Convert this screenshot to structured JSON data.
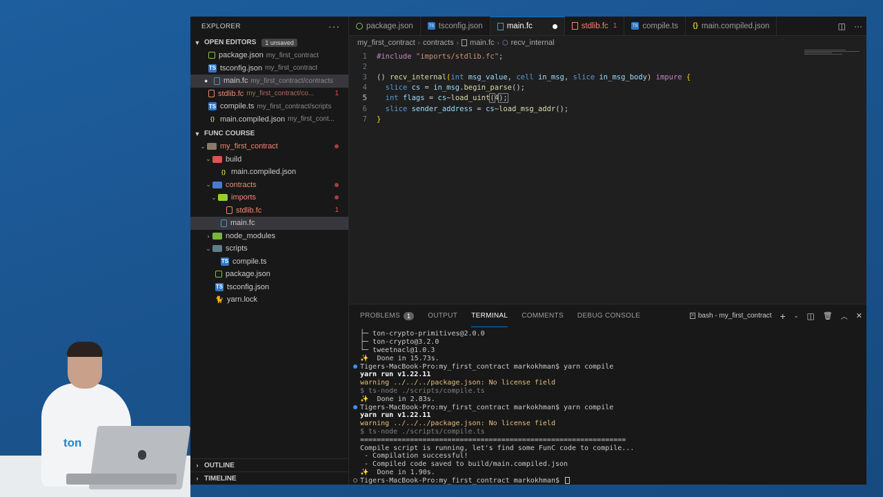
{
  "sidebar": {
    "header": "EXPLORER",
    "open_editors": {
      "title": "OPEN EDITORS",
      "badge": "1 unsaved",
      "items": [
        {
          "name": "package.json",
          "desc": "my_first_contract"
        },
        {
          "name": "tsconfig.json",
          "desc": "my_first_contract"
        },
        {
          "name": "main.fc",
          "desc": "my_first_contract/contracts"
        },
        {
          "name": "stdlib.fc",
          "desc": "my_first_contract/co...",
          "errors": "1"
        },
        {
          "name": "compile.ts",
          "desc": "my_first_contract/scripts"
        },
        {
          "name": "main.compiled.json",
          "desc": "my_first_cont..."
        }
      ]
    },
    "workspace": {
      "title": "FUNC COURSE",
      "items": [
        {
          "name": "my_first_contract"
        },
        {
          "name": "build"
        },
        {
          "name": "main.compiled.json"
        },
        {
          "name": "contracts"
        },
        {
          "name": "imports"
        },
        {
          "name": "stdlib.fc",
          "errors": "1"
        },
        {
          "name": "main.fc"
        },
        {
          "name": "node_modules"
        },
        {
          "name": "scripts"
        },
        {
          "name": "compile.ts"
        },
        {
          "name": "package.json"
        },
        {
          "name": "tsconfig.json"
        },
        {
          "name": "yarn.lock"
        }
      ]
    },
    "outline": "OUTLINE",
    "timeline": "TIMELINE"
  },
  "tabs": [
    {
      "label": "package.json"
    },
    {
      "label": "tsconfig.json"
    },
    {
      "label": "main.fc"
    },
    {
      "label": "stdlib.fc",
      "errors": "1"
    },
    {
      "label": "compile.ts"
    },
    {
      "label": "main.compiled.json"
    }
  ],
  "breadcrumb": [
    "my_first_contract",
    "contracts",
    "main.fc",
    "recv_internal"
  ],
  "code": {
    "line_numbers": [
      "1",
      "2",
      "3",
      "4",
      "5",
      "6",
      "7"
    ],
    "l1_include": "#include",
    "l1_path": "\"imports/stdlib.fc\"",
    "l1_end": ";",
    "l3_open": "() ",
    "l3_fn": "recv_internal",
    "l3_p1": "(",
    "l3_int": "int",
    "l3_msg_value": " msg_value",
    "l3_c1": ", ",
    "l3_cell": "cell",
    "l3_in_msg": " in_msg",
    "l3_c2": ", ",
    "l3_slice": "slice",
    "l3_in_msg_body": " in_msg_body",
    "l3_p2": ") ",
    "l3_impure": "impure",
    "l3_brace": " {",
    "l4_slice": "slice",
    "l4_cs": " cs",
    "l4_eq": " = ",
    "l4_in_msg": "in_msg",
    "l4_dot": ".",
    "l4_fn": "begin_parse",
    "l4_end": "();",
    "l5_int": "int",
    "l5_flags": " flags",
    "l5_eq": " = ",
    "l5_cs": "cs",
    "l5_tilde": "~",
    "l5_fn": "load_uint",
    "l5_p1": "(",
    "l5_num": "4",
    "l5_end": ");",
    "l6_slice": "slice",
    "l6_sender": " sender_address",
    "l6_eq": " = ",
    "l6_cs": "cs",
    "l6_tilde": "~",
    "l6_fn": "load_msg_addr",
    "l6_end": "();",
    "l7": "}"
  },
  "panel": {
    "tabs": [
      "PROBLEMS",
      "OUTPUT",
      "TERMINAL",
      "COMMENTS",
      "DEBUG CONSOLE"
    ],
    "problems_count": "1",
    "shell_label": "bash - my_first_contract"
  },
  "terminal": [
    {
      "text": "├─ ton-crypto-primitives@2.0.0",
      "style": "normal"
    },
    {
      "text": "├─ ton-crypto@3.2.0",
      "style": "normal"
    },
    {
      "text": "└─ tweetnacl@1.0.3",
      "style": "normal"
    },
    {
      "text": "✨  Done in 15.73s.",
      "style": "normal"
    },
    {
      "text": "Tigers-MacBook-Pro:my_first_contract markokhman$ yarn compile",
      "style": "normal"
    },
    {
      "text": "yarn run v1.22.11",
      "style": "bold"
    },
    {
      "text": "warning ../../../package.json: No license field",
      "style": "warn"
    },
    {
      "text": "$ ts-node ./scripts/compile.ts",
      "style": "dim"
    },
    {
      "text": "✨  Done in 2.83s.",
      "style": "normal"
    },
    {
      "text": "Tigers-MacBook-Pro:my_first_contract markokhman$ yarn compile",
      "style": "normal"
    },
    {
      "text": "yarn run v1.22.11",
      "style": "bold"
    },
    {
      "text": "warning ../../../package.json: No license field",
      "style": "warn"
    },
    {
      "text": "$ ts-node ./scripts/compile.ts",
      "style": "dim"
    },
    {
      "text": "================================================================",
      "style": "normal"
    },
    {
      "text": "Compile script is running, let's find some FunC code to compile...",
      "style": "normal"
    },
    {
      "text": " - Compilation successful!",
      "style": "normal"
    },
    {
      "text": " - Compiled code saved to build/main.compiled.json",
      "style": "normal"
    },
    {
      "text": "✨  Done in 1.90s.",
      "style": "normal"
    },
    {
      "text": "Tigers-MacBook-Pro:my_first_contract markokhman$ ",
      "style": "normal"
    }
  ],
  "presenter_logo": "ton"
}
